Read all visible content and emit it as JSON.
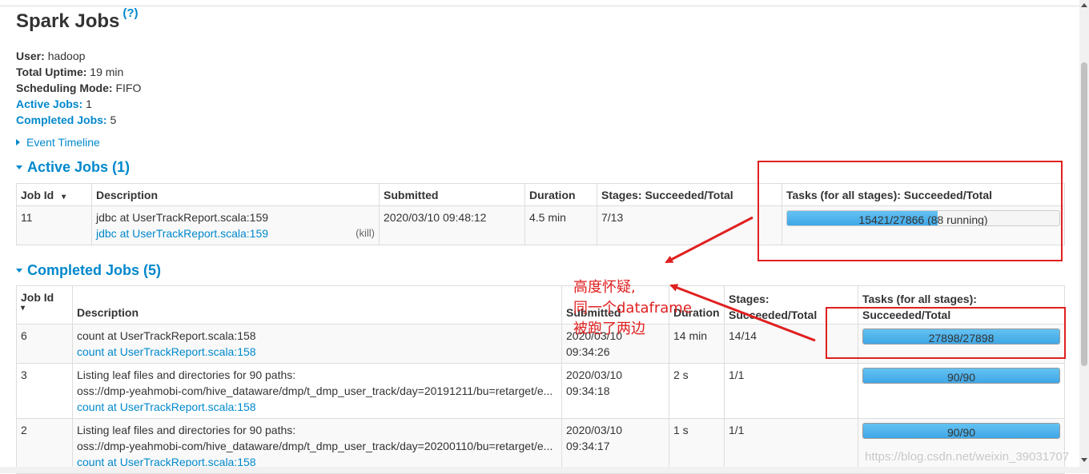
{
  "header": {
    "title": "Spark Jobs",
    "help": "(?)"
  },
  "summary": {
    "user_label": "User:",
    "user": "hadoop",
    "uptime_label": "Total Uptime:",
    "uptime": "19 min",
    "mode_label": "Scheduling Mode:",
    "mode": "FIFO",
    "active_label": "Active Jobs:",
    "active": "1",
    "completed_label": "Completed Jobs:",
    "completed": "5"
  },
  "event_timeline": "Event Timeline",
  "active": {
    "title": "Active Jobs (1)",
    "headers": [
      "Job Id",
      "Description",
      "Submitted",
      "Duration",
      "Stages: Succeeded/Total",
      "Tasks (for all stages): Succeeded/Total"
    ],
    "sort_icon": "▾",
    "rows": [
      {
        "id": "11",
        "desc": "jdbc at UserTrackReport.scala:159",
        "link": "jdbc at UserTrackReport.scala:159",
        "kill": "(kill)",
        "submitted": "2020/03/10 09:48:12",
        "duration": "4.5 min",
        "stages": "7/13",
        "tasks": "15421/27866 (88 running)",
        "progress": 0.5534,
        "running": 0.0032
      }
    ]
  },
  "completed": {
    "title": "Completed Jobs (5)",
    "headers": [
      "Job Id",
      "Description",
      "Submitted",
      "Duration",
      "Stages:",
      "Succeeded/Total",
      "Tasks (for all stages):",
      "Succeeded/Total"
    ],
    "sort_icon": "▾",
    "rows": [
      {
        "id": "6",
        "desc": "count at UserTrackReport.scala:158",
        "desc2": "",
        "link": "count at UserTrackReport.scala:158",
        "submitted_date": "2020/03/10",
        "submitted_time": "09:34:26",
        "duration": "14 min",
        "stages": "14/14",
        "tasks": "27898/27898",
        "progress": 1.0
      },
      {
        "id": "3",
        "desc": "Listing leaf files and directories for 90 paths:",
        "desc2": "oss://dmp-yeahmobi-com/hive_dataware/dmp/t_dmp_user_track/day=20191211/bu=retarget/e...",
        "link": "count at UserTrackReport.scala:158",
        "submitted_date": "2020/03/10",
        "submitted_time": "09:34:18",
        "duration": "2 s",
        "stages": "1/1",
        "tasks": "90/90",
        "progress": 1.0
      },
      {
        "id": "2",
        "desc": "Listing leaf files and directories for 90 paths:",
        "desc2": "oss://dmp-yeahmobi-com/hive_dataware/dmp/t_dmp_user_track/day=20200110/bu=retarget/e...",
        "link": "count at UserTrackReport.scala:158",
        "submitted_date": "2020/03/10",
        "submitted_time": "09:34:17",
        "duration": "1 s",
        "stages": "1/1",
        "tasks": "90/90",
        "progress": 1.0
      }
    ]
  },
  "annotation": {
    "line1": "高度怀疑,",
    "line2": "同一个dataframe",
    "line3": "被跑了两边",
    "color": "#e02020"
  },
  "watermark": "https://blog.csdn.net/weixin_39031707"
}
